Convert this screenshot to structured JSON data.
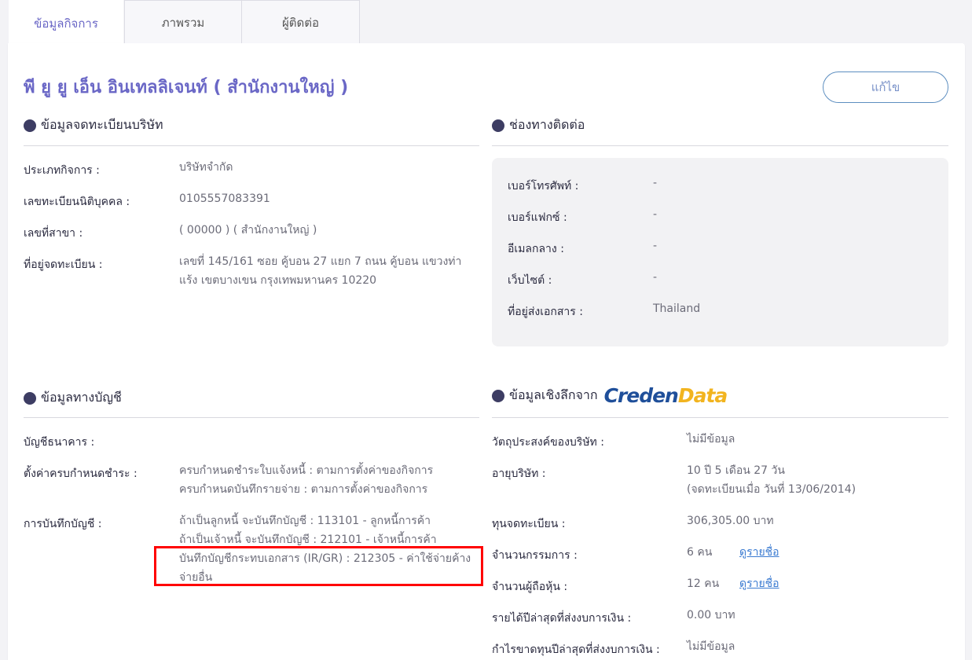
{
  "tabs": [
    {
      "label": "ข้อมูลกิจการ"
    },
    {
      "label": "ภาพรวม"
    },
    {
      "label": "ผู้ติดต่อ"
    }
  ],
  "page_title": "พี ยู ยู เอ็น อินเทลลิเจนท์ ( สำนักงานใหญ่ )",
  "edit_label": "แก้ไข",
  "registration": {
    "heading": "ข้อมูลจดทะเบียนบริษัท",
    "rows": [
      {
        "label": "ประเภทกิจการ :",
        "value": "บริษัทจำกัด"
      },
      {
        "label": "เลขทะเบียนนิติบุคคล :",
        "value": "0105557083391"
      },
      {
        "label": "เลขที่สาขา :",
        "value": "( 00000 ) ( สำนักงานใหญ่ )"
      },
      {
        "label": "ที่อยู่จดทะเบียน :",
        "value_line1": "เลขที่ 145/161 ซอย คู้บอน 27 แยก 7 ถนน คู้บอน แขวงท่า",
        "value_line2": "แร้ง เขตบางเขน กรุงเทพมหานคร 10220"
      }
    ]
  },
  "contact": {
    "heading": "ช่องทางติดต่อ",
    "rows": [
      {
        "label": "เบอร์โทรศัพท์ :",
        "value": "-"
      },
      {
        "label": "เบอร์แฟกซ์ :",
        "value": "-"
      },
      {
        "label": "อีเมลกลาง :",
        "value": "-"
      },
      {
        "label": "เว็บไซต์ :",
        "value": "-"
      },
      {
        "label": "ที่อยู่ส่งเอกสาร :",
        "value": "Thailand"
      }
    ]
  },
  "accounting": {
    "heading": "ข้อมูลทางบัญชี",
    "bank_label": "บัญชีธนาคาร :",
    "due_label": "ตั้งค่าครบกำหนดชำระ :",
    "due_line1": "ครบกำหนดชำระใบแจ้งหนี้ : ตามการตั้งค่าของกิจการ",
    "due_line2": "ครบกำหนดบันทึกรายจ่าย : ตามการตั้งค่าของกิจการ",
    "record_label": "การบันทึกบัญชี :",
    "record_line1": "ถ้าเป็นลูกหนี้ จะบันทึกบัญชี : 113101 - ลูกหนี้การค้า",
    "record_line2": "ถ้าเป็นเจ้าหนี้ จะบันทึกบัญชี : 212101 - เจ้าหนี้การค้า",
    "record_line3": "บันทึกบัญชีกระทบเอกสาร (IR/GR) : 212305 - ค่าใช้จ่ายค้าง",
    "record_line4": "จ่ายอื่น"
  },
  "insight": {
    "heading": "ข้อมูลเชิงลึกจาก",
    "logo_part1": "Creden",
    "logo_part2": "Data",
    "purpose_label": "วัตถุประสงค์ของบริษัท :",
    "purpose_value": "ไม่มีข้อมูล",
    "age_label": "อายุบริษัท :",
    "age_line1": "10 ปี 5 เดือน 27 วัน",
    "age_line2": "(จดทะเบียนเมื่อ วันที่ 13/06/2014)",
    "capital_label": "ทุนจดทะเบียน :",
    "capital_value": "306,305.00 บาท",
    "directors_label": "จำนวนกรรมการ :",
    "directors_value": "6 คน",
    "directors_link": "ดูรายชื่อ",
    "shareholders_label": "จำนวนผู้ถือหุ้น :",
    "shareholders_value": "12 คน",
    "shareholders_link": "ดูรายชื่อ",
    "revenue_label": "รายได้ปีล่าสุดที่ส่งงบการเงิน :",
    "revenue_value": "0.00 บาท",
    "profit_label": "กำไรขาดทุนปีล่าสุดที่ส่งงบการเงิน :",
    "profit_value": "ไม่มีข้อมูล"
  }
}
